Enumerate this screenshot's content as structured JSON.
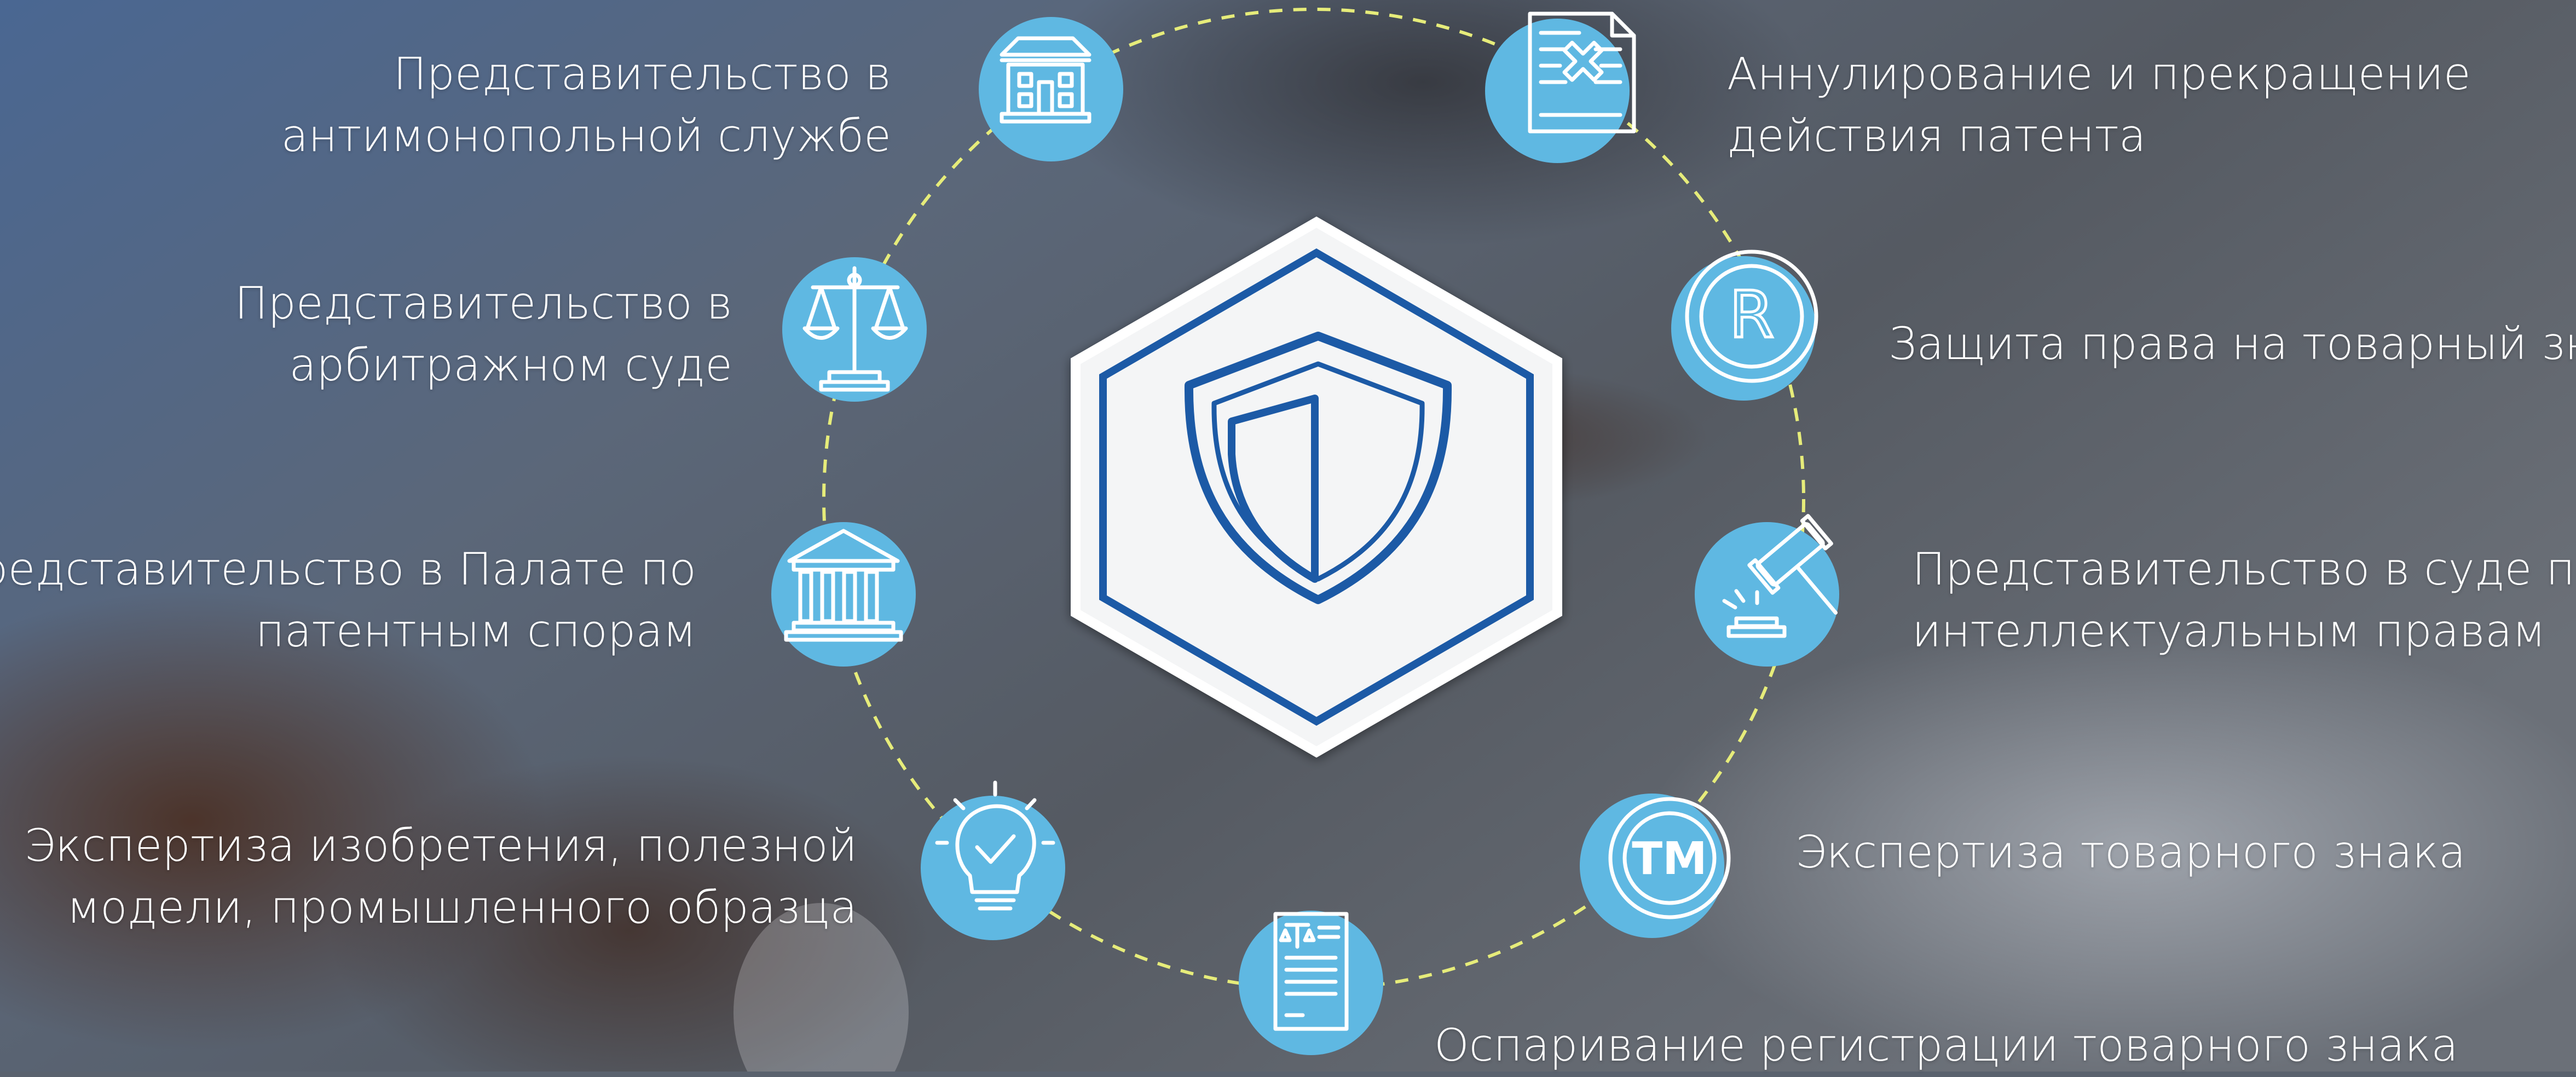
{
  "colors": {
    "accent": "#5fb8e2",
    "ring": "#e6ec7a",
    "shield_blue": "#1f5aa6",
    "text": "#ffffff"
  },
  "center_icon": "shield-icon",
  "services": [
    {
      "id": "antimonopoly",
      "icon": "government-building-icon",
      "lines": [
        "Представительство в",
        "антимонопольной службе"
      ]
    },
    {
      "id": "arbitration",
      "icon": "scales-icon",
      "lines": [
        "Представительство в",
        "арбитражном суде"
      ]
    },
    {
      "id": "patent-chamber",
      "icon": "courthouse-columns-icon",
      "lines": [
        "Представительство в Палате по",
        "патентным спорам"
      ]
    },
    {
      "id": "invention-expertise",
      "icon": "lightbulb-check-icon",
      "lines": [
        "Экспертиза изобретения, полезной",
        "модели, промышленного образца"
      ]
    },
    {
      "id": "trademark-challenge",
      "icon": "legal-document-icon",
      "lines": [
        "Оспаривание регистрации товарного знака"
      ]
    },
    {
      "id": "trademark-expertise",
      "icon": "trademark-tm-icon",
      "lines": [
        "Экспертиза товарного знака"
      ]
    },
    {
      "id": "ip-court",
      "icon": "gavel-icon",
      "lines": [
        "Представительство в суде по",
        "интеллектуальным правам"
      ]
    },
    {
      "id": "trademark-protection",
      "icon": "registered-r-icon",
      "lines": [
        "Защита права на товарный знак"
      ]
    },
    {
      "id": "patent-annulment",
      "icon": "cancel-document-icon",
      "lines": [
        "Аннулирование и прекращение",
        "действия патента"
      ]
    }
  ]
}
